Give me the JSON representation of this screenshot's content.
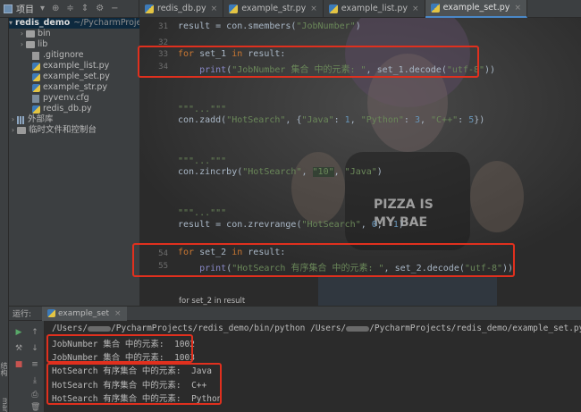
{
  "project_tool": {
    "label": "项目"
  },
  "tabs": [
    {
      "name": "redis_db.py",
      "active": false
    },
    {
      "name": "example_str.py",
      "active": false
    },
    {
      "name": "example_list.py",
      "active": false
    },
    {
      "name": "example_set.py",
      "active": true
    }
  ],
  "project_tree": {
    "root_name": "redis_demo",
    "root_path": "~/PycharmProjects",
    "items": [
      "bin",
      "lib",
      ".gitignore",
      "example_list.py",
      "example_set.py",
      "example_str.py",
      "pyvenv.cfg",
      "redis_db.py"
    ],
    "external_libs": "外部库",
    "scratches": "临时文件和控制台"
  },
  "editor": {
    "lines": [
      {
        "no": "31",
        "code": "result = con.smembers(\"JobNumber\")"
      },
      {
        "no": "32",
        "code": ""
      },
      {
        "no": "33",
        "code": "for set_1 in result:"
      },
      {
        "no": "34",
        "code": "    print(\"JobNumber 集合 中的元素: \", set_1.decode(\"utf-8\"))"
      },
      {
        "no": "",
        "code": ""
      },
      {
        "no": "",
        "code": "\"\"\"...\"\"\""
      },
      {
        "no": "",
        "code": "con.zadd(\"HotSearch\", {\"Java\": 1, \"Python\": 3, \"C++\": 5})"
      },
      {
        "no": "",
        "code": ""
      },
      {
        "no": "",
        "code": "\"\"\"...\"\"\""
      },
      {
        "no": "",
        "code": "con.zincrby(\"HotSearch\", \"10\", \"Java\")"
      },
      {
        "no": "",
        "code": ""
      },
      {
        "no": "",
        "code": "\"\"\"...\"\"\""
      },
      {
        "no": "",
        "code": "result = con.zrevrange(\"HotSearch\", 0, -1)"
      },
      {
        "no": "",
        "code": ""
      },
      {
        "no": "54",
        "code": "for set_2 in result:"
      },
      {
        "no": "55",
        "code": "    print(\"HotSearch 有序集合 中的元素: \", set_2.decode(\"utf-8\"))"
      }
    ]
  },
  "breadcrumb": "for set_2 in result",
  "run": {
    "label": "运行:",
    "tab": "example_set",
    "command_a": "/Users/",
    "command_b": "/PycharmProjects/redis_demo/bin/python /Users/",
    "command_c": "/PycharmProjects/redis_demo/example_set.py",
    "output": [
      "JobNumber 集合 中的元素:  1002",
      "JobNumber 集合 中的元素:  1003",
      "HotSearch 有序集合 中的元素:  Java",
      "HotSearch 有序集合 中的元素:  C++",
      "HotSearch 有序集合 中的元素:  Python"
    ]
  },
  "left_strip": {
    "structure": "结构",
    "bookmarks": "marks"
  },
  "colors": {
    "highlight_box": "#e0301e",
    "keyword": "#cc7832",
    "string": "#6a8759",
    "number": "#6897bb"
  }
}
